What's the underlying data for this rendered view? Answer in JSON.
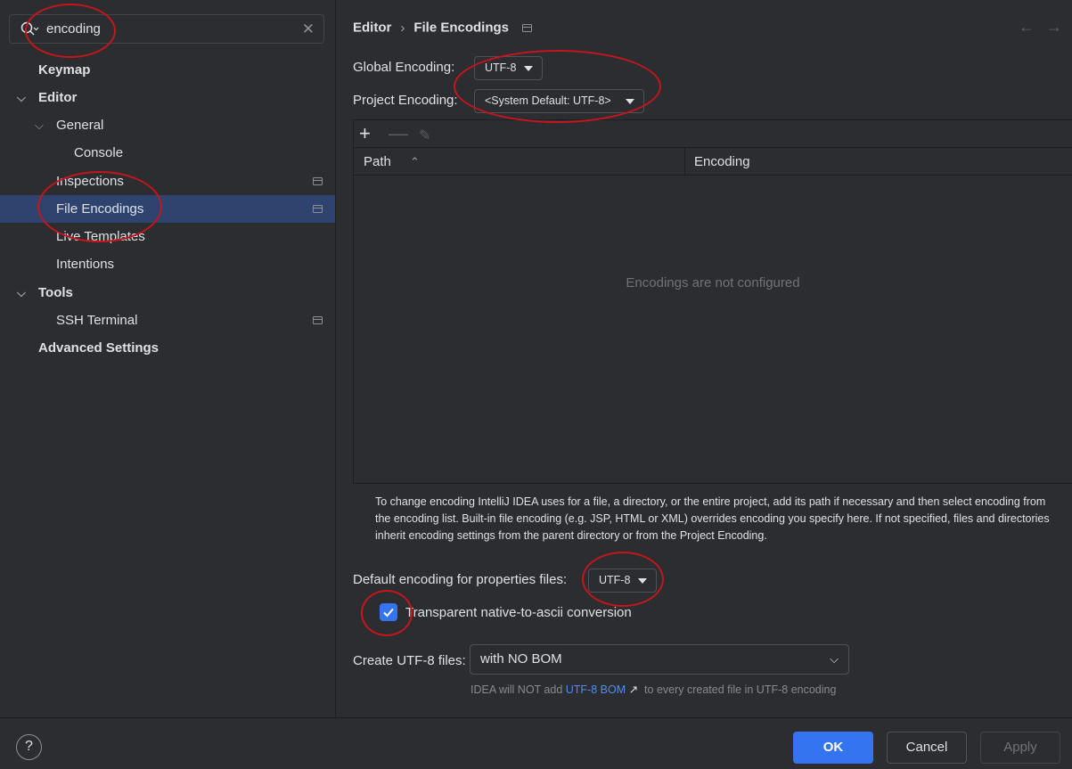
{
  "search": {
    "value": "encoding"
  },
  "tree": {
    "keymap": "Keymap",
    "editor": "Editor",
    "general": "General",
    "console": "Console",
    "inspections": "Inspections",
    "file_encodings": "File Encodings",
    "live_templates": "Live Templates",
    "intentions": "Intentions",
    "tools": "Tools",
    "ssh_terminal": "SSH Terminal",
    "advanced_settings": "Advanced Settings"
  },
  "breadcrumb": {
    "parent": "Editor",
    "current": "File Encodings"
  },
  "form": {
    "global_encoding_label": "Global Encoding:",
    "global_encoding_value": "UTF-8",
    "project_encoding_label": "Project Encoding:",
    "project_encoding_value": "<System Default: UTF-8>",
    "table_col_path": "Path",
    "table_col_encoding": "Encoding",
    "table_empty": "Encodings are not configured",
    "help_text": "To change encoding IntelliJ IDEA uses for a file, a directory, or the entire project, add its path if necessary and then select encoding from the encoding list. Built-in file encoding (e.g. JSP, HTML or XML) overrides encoding you specify here. If not specified, files and directories inherit encoding settings from the parent directory or from the Project Encoding.",
    "properties_label": "Default encoding for properties files:",
    "properties_value": "UTF-8",
    "native_to_ascii_label": "Transparent native-to-ascii conversion",
    "native_to_ascii_checked": true,
    "create_utf8_label": "Create UTF-8 files:",
    "create_utf8_value": "with NO BOM",
    "bom_note_prefix": "IDEA will NOT add",
    "bom_note_link": "UTF-8 BOM",
    "bom_note_suffix": "to every created file in UTF-8 encoding"
  },
  "footer": {
    "help": "?",
    "ok": "OK",
    "cancel": "Cancel",
    "apply": "Apply"
  },
  "colors": {
    "background": "#2b2d30",
    "selection": "#2e436e",
    "accent": "#3574f0",
    "link": "#548af7",
    "annotation": "#c4161c"
  },
  "icons": [
    "search-icon",
    "clear-icon",
    "chevron-down-icon",
    "project-scope-icon",
    "back-arrow-icon",
    "forward-arrow-icon",
    "add-icon",
    "remove-icon",
    "edit-icon",
    "sort-ascending-icon",
    "external-link-icon",
    "help-icon"
  ]
}
